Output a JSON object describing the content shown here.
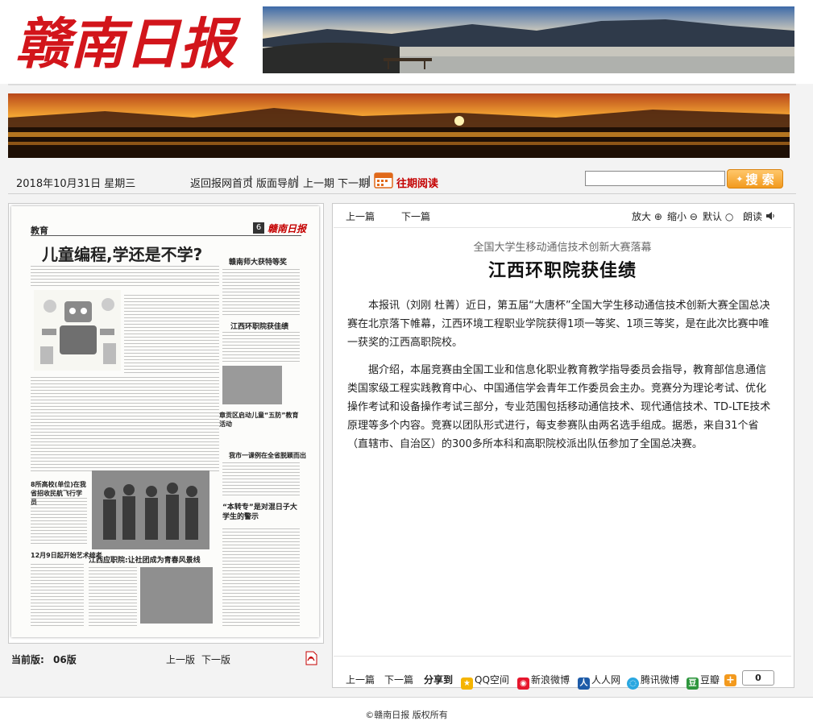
{
  "masthead": {
    "title": "赣南日报"
  },
  "colors": {
    "masthead_red": "#d2151b",
    "accent_red": "#c40000",
    "search_orange": "#f29a1e"
  },
  "nav": {
    "date": "2018年10月31日 星期三",
    "links": [
      "返回报网首页",
      "版面导航",
      "上一期",
      "下一期"
    ],
    "separator": "|",
    "archive_label": "往期阅读",
    "search_placeholder": "",
    "search_button": "搜 索"
  },
  "newspaper": {
    "section": "教育",
    "page_no": "6",
    "masthead_small": "赣南日报",
    "main_headline": "儿童编程,学还是不学?",
    "headline2": "赣南师大获特等奖",
    "headline3": "江西环职院获佳绩",
    "headline4": "章贡区启动儿童“五防”教育活动",
    "headline5": "我市一课例在全省脱颖而出",
    "headline6": "8所高校(单位)在我省招收民航飞行学员",
    "headline7": "“本转专”是对混日子大学生的警示",
    "headline8": "12月9日起开始艺术统考",
    "headline9": "江西应职院:让社团成为青春风景线"
  },
  "page_info": {
    "current_label": "当前版:",
    "current_value": "06版",
    "prev": "上一版",
    "next": "下一版",
    "pdf_icon": "pdf-icon"
  },
  "article": {
    "toolbar": {
      "prev": "上一篇",
      "next": "下一篇",
      "zoom_in": "放大",
      "zoom_out": "缩小",
      "default": "默认",
      "read_aloud": "朗读"
    },
    "kicker": "全国大学生移动通信技术创新大赛落幕",
    "headline": "江西环职院获佳绩",
    "paragraphs": [
      "本报讯（刘刚 杜菁）近日，第五届“大唐杯”全国大学生移动通信技术创新大赛全国总决赛在北京落下帷幕，江西环境工程职业学院获得1项一等奖、1项三等奖，是在此次比赛中唯一获奖的江西高职院校。",
      "据介绍，本届竞赛由全国工业和信息化职业教育教学指导委员会指导，教育部信息通信类国家级工程实践教育中心、中国通信学会青年工作委员会主办。竞赛分为理论考试、优化操作考试和设备操作考试三部分，专业范围包括移动通信技术、现代通信技术、TD-LTE技术原理等多个内容。竞赛以团队形式进行，每支参赛队由两名选手组成。据悉，来自31个省（直辖市、自治区）的300多所本科和高职院校派出队伍参加了全国总决赛。"
    ]
  },
  "share": {
    "prev": "上一篇",
    "next": "下一篇",
    "label": "分享到",
    "targets": [
      "QQ空间",
      "新浪微博",
      "人人网",
      "腾讯微博",
      "豆瓣"
    ],
    "count": "0"
  },
  "footer": {
    "copyright": "©赣南日报 版权所有"
  }
}
